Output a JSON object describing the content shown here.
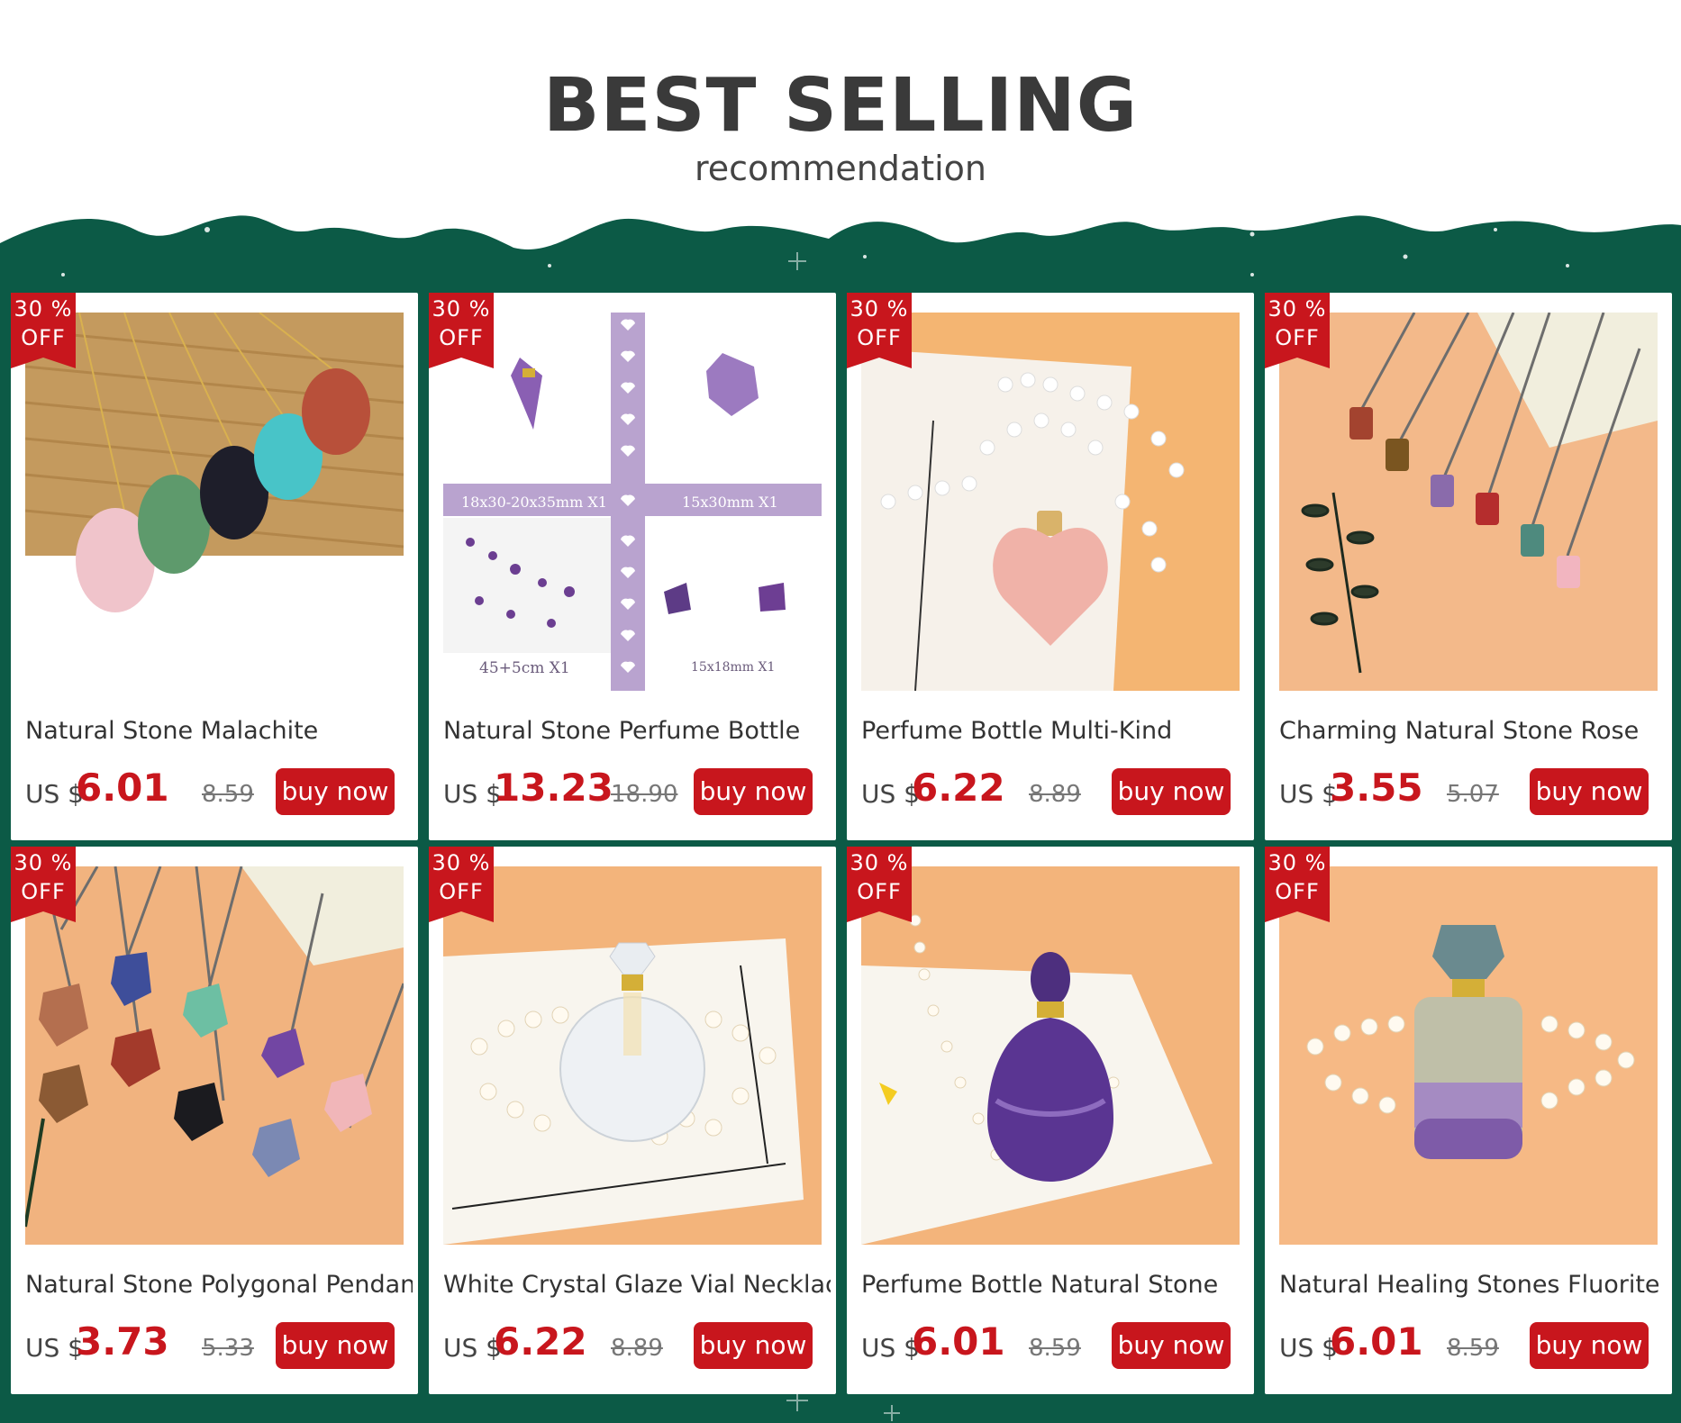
{
  "header": {
    "title": "BEST SELLING",
    "subtitle": "recommendation"
  },
  "colors": {
    "background_green": "#0c5a46",
    "badge_red": "#c8161d",
    "price_red": "#c8161d",
    "button_red": "#c8161d"
  },
  "products": [
    {
      "name": "Natural Stone Malachite",
      "currency": "US $",
      "price": "6.01",
      "original": "8.59",
      "badge_line1": "30 %",
      "badge_line2": "OFF",
      "button": "buy now",
      "image": "teardrop-pendants-image"
    },
    {
      "name": "Natural Stone Perfume Bottle",
      "currency": "US $",
      "price": "13.23",
      "original": "18.90",
      "badge_line1": "30 %",
      "badge_line2": "OFF",
      "button": "buy now",
      "image": "amethyst-set-image",
      "image_labels": {
        "a": "18x30-20x35mm X1",
        "b": "15x30mm X1",
        "c": "45+5cm X1",
        "d": "15x18mm X1"
      }
    },
    {
      "name": "Perfume Bottle Multi-Kind",
      "currency": "US $",
      "price": "6.22",
      "original": "8.89",
      "badge_line1": "30 %",
      "badge_line2": "OFF",
      "button": "buy now",
      "image": "rose-quartz-heart-image"
    },
    {
      "name": "Charming Natural Stone Rose",
      "currency": "US $",
      "price": "3.55",
      "original": "5.07",
      "badge_line1": "30 %",
      "badge_line2": "OFF",
      "button": "buy now",
      "image": "cylinder-pendants-image"
    },
    {
      "name": "Natural Stone Polygonal Pendant",
      "currency": "US $",
      "price": "3.73",
      "original": "5.33",
      "badge_line1": "30 %",
      "badge_line2": "OFF",
      "button": "buy now",
      "image": "polygonal-pendants-image"
    },
    {
      "name": "White Crystal Glaze Vial Necklace",
      "currency": "US $",
      "price": "6.22",
      "original": "8.89",
      "badge_line1": "30 %",
      "badge_line2": "OFF",
      "button": "buy now",
      "image": "clear-crystal-vial-image"
    },
    {
      "name": "Perfume Bottle Natural Stone",
      "currency": "US $",
      "price": "6.01",
      "original": "8.59",
      "badge_line1": "30 %",
      "badge_line2": "OFF",
      "button": "buy now",
      "image": "amethyst-vial-image"
    },
    {
      "name": "Natural Healing Stones Fluorite",
      "currency": "US $",
      "price": "6.01",
      "original": "8.59",
      "badge_line1": "30 %",
      "badge_line2": "OFF",
      "button": "buy now",
      "image": "fluorite-vial-image"
    }
  ]
}
